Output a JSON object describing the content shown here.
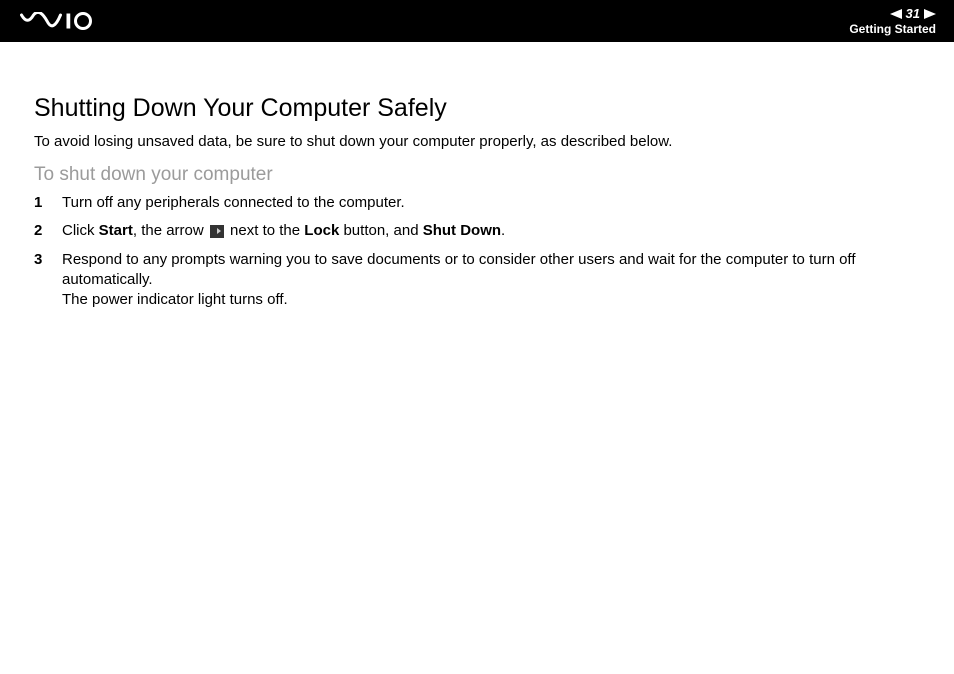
{
  "header": {
    "page_number": "31",
    "section": "Getting Started"
  },
  "content": {
    "title": "Shutting Down Your Computer Safely",
    "intro": "To avoid losing unsaved data, be sure to shut down your computer properly, as described below.",
    "subheading": "To shut down your computer",
    "steps": [
      {
        "num": "1",
        "text": "Turn off any peripherals connected to the computer."
      },
      {
        "num": "2",
        "prefix": "Click ",
        "bold1": "Start",
        "mid1": ", the arrow ",
        "mid2": " next to the ",
        "bold2": "Lock",
        "mid3": " button, and ",
        "bold3": "Shut Down",
        "suffix": "."
      },
      {
        "num": "3",
        "line1": "Respond to any prompts warning you to save documents or to consider other users and wait for the computer to turn off automatically.",
        "line2": "The power indicator light turns off."
      }
    ]
  }
}
